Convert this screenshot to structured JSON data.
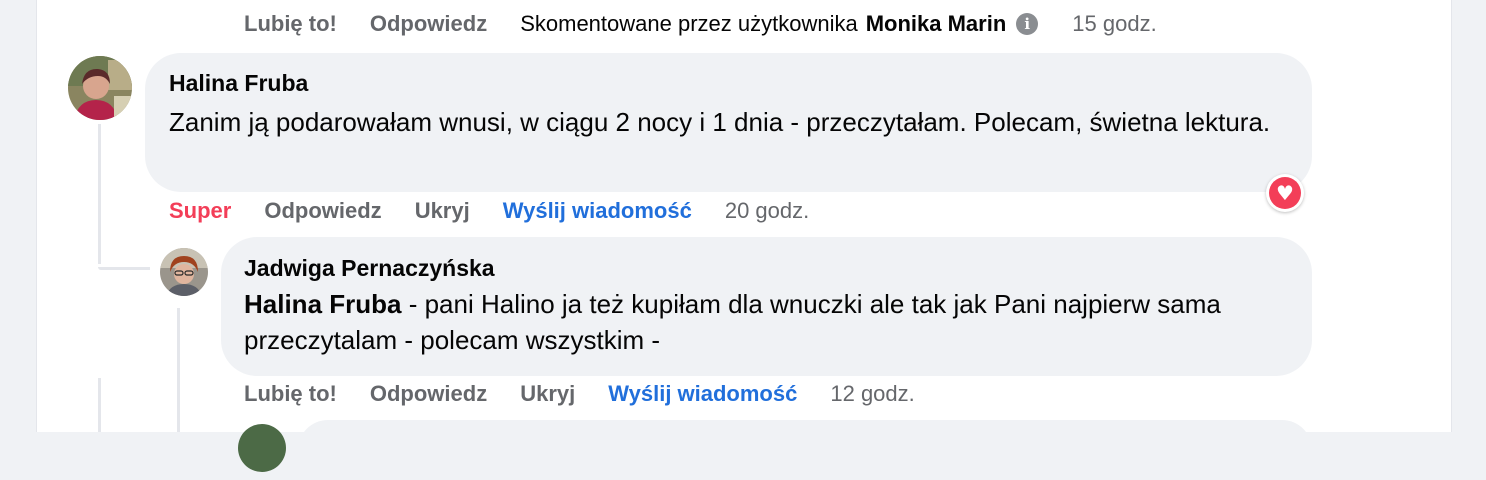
{
  "top_comment_actions": {
    "like": "Lubię to!",
    "reply": "Odpowiedz",
    "commented_by_prefix": "Skomentowane przez użytkownika",
    "commented_by_name": "Monika Marin",
    "info_glyph": "i",
    "time": "15 godz."
  },
  "comments": [
    {
      "author": "Halina Fruba",
      "text": "Zanim ją podarowałam wnusi, w ciągu 2 nocy i 1 dnia - przeczytałam. Polecam, świetna lektura.",
      "reaction": "Super",
      "reaction_icon": "heart-icon",
      "reaction_glyph": "♥",
      "reply": "Odpowiedz",
      "hide": "Ukryj",
      "message": "Wyślij wiadomość",
      "time": "20 godz."
    },
    {
      "author": "Jadwiga Pernaczyńska",
      "mention": "Halina Fruba",
      "text": " - pani Halino ja też kupiłam dla wnuczki ale tak jak Pani najpierw sama przeczytalam - polecam wszystkim -",
      "like": "Lubię to!",
      "reply": "Odpowiedz",
      "hide": "Ukryj",
      "message": "Wyślij wiadomość",
      "time": "12 godz."
    }
  ],
  "colors": {
    "link_blue": "#216fdb",
    "reaction_red": "#f33e58",
    "muted": "#65676b",
    "bubble": "#f0f2f5"
  }
}
